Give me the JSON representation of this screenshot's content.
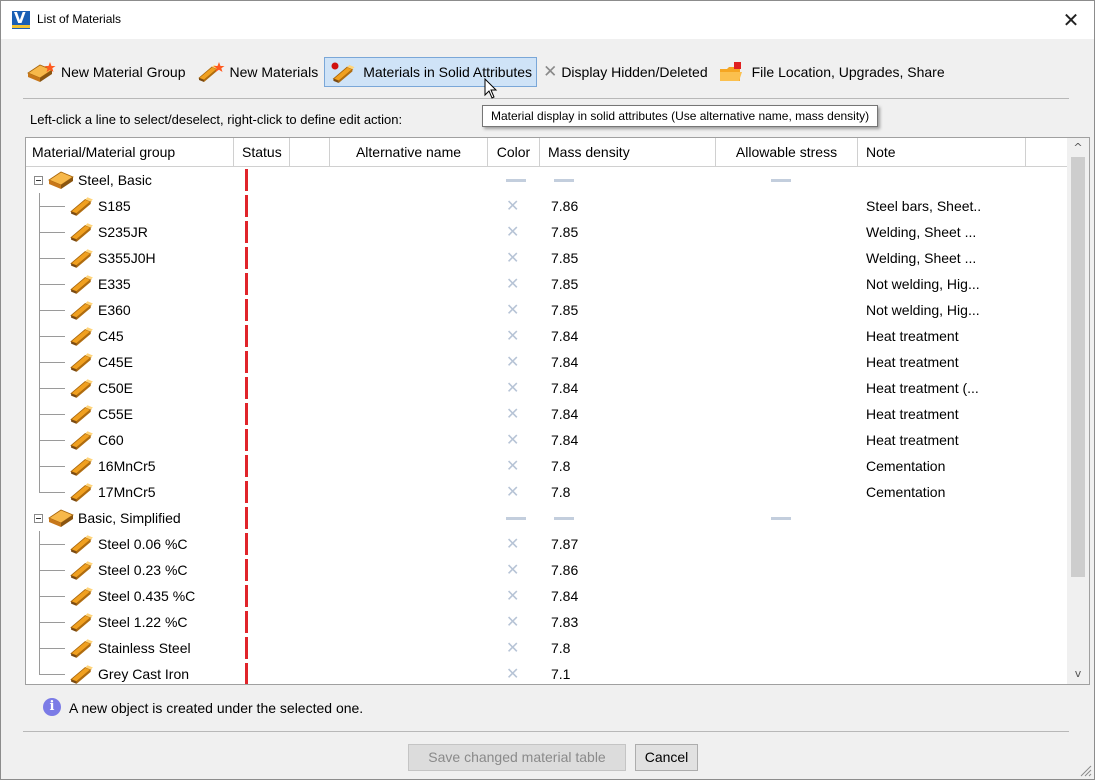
{
  "window": {
    "title": "List of Materials",
    "close_glyph": "✕",
    "app_icon_letter": "V"
  },
  "toolbar": {
    "new_group": "New Material Group",
    "new_materials": "New Materials",
    "solid_attributes": "Materials in Solid Attributes",
    "hidden_icon_glyph": "✕",
    "hidden_deleted": "Display Hidden/Deleted",
    "file_location": "File Location, Upgrades, Share"
  },
  "hint": "Left-click a line to select/deselect, right-click to define edit action:",
  "tooltip": "Material display in solid attributes (Use alternative name, mass density)",
  "table": {
    "columns": {
      "material": "Material/Material group",
      "status": "Status",
      "blank": "",
      "alt_name": "Alternative name",
      "color": "Color",
      "mass_density": "Mass density",
      "allowable_stress": "Allowable stress",
      "note": "Note"
    },
    "color_glyph": "✕",
    "rows": [
      {
        "type": "group",
        "name": "Steel, Basic",
        "density": "",
        "note": ""
      },
      {
        "type": "item",
        "name": "S185",
        "density": "7.86",
        "note": "Steel bars, Sheet.."
      },
      {
        "type": "item",
        "name": "S235JR",
        "density": "7.85",
        "note": "Welding, Sheet ..."
      },
      {
        "type": "item",
        "name": "S355J0H",
        "density": "7.85",
        "note": "Welding, Sheet ..."
      },
      {
        "type": "item",
        "name": "E335",
        "density": "7.85",
        "note": "Not welding, Hig..."
      },
      {
        "type": "item",
        "name": "E360",
        "density": "7.85",
        "note": "Not welding, Hig..."
      },
      {
        "type": "item",
        "name": "C45",
        "density": "7.84",
        "note": "Heat treatment"
      },
      {
        "type": "item",
        "name": "C45E",
        "density": "7.84",
        "note": "Heat treatment"
      },
      {
        "type": "item",
        "name": "C50E",
        "density": "7.84",
        "note": "Heat treatment (..."
      },
      {
        "type": "item",
        "name": "C55E",
        "density": "7.84",
        "note": "Heat treatment"
      },
      {
        "type": "item",
        "name": "C60",
        "density": "7.84",
        "note": "Heat treatment"
      },
      {
        "type": "item",
        "name": "16MnCr5",
        "density": "7.8",
        "note": "Cementation"
      },
      {
        "type": "item",
        "name": "17MnCr5",
        "density": "7.8",
        "note": "Cementation",
        "last": true
      },
      {
        "type": "group",
        "name": "Basic, Simplified",
        "density": "",
        "note": ""
      },
      {
        "type": "item",
        "name": "Steel 0.06 %C",
        "density": "7.87",
        "note": ""
      },
      {
        "type": "item",
        "name": "Steel 0.23 %C",
        "density": "7.86",
        "note": ""
      },
      {
        "type": "item",
        "name": "Steel 0.435 %C",
        "density": "7.84",
        "note": ""
      },
      {
        "type": "item",
        "name": "Steel 1.22 %C",
        "density": "7.83",
        "note": ""
      },
      {
        "type": "item",
        "name": "Stainless Steel",
        "density": "7.8",
        "note": ""
      },
      {
        "type": "item",
        "name": "Grey Cast Iron",
        "density": "7.1",
        "note": ""
      }
    ]
  },
  "scrollbar": {
    "up_glyph": "^",
    "down_glyph": "v"
  },
  "info": {
    "icon_glyph": "i",
    "message": "A new object is created under the selected one."
  },
  "buttons": {
    "save": "Save changed material table",
    "cancel": "Cancel"
  },
  "colors": {
    "status_red": "#e0242a",
    "selection_blue": "#cfe3f7",
    "info_purple": "#7b7be6",
    "material_orange": "#f0a020"
  }
}
